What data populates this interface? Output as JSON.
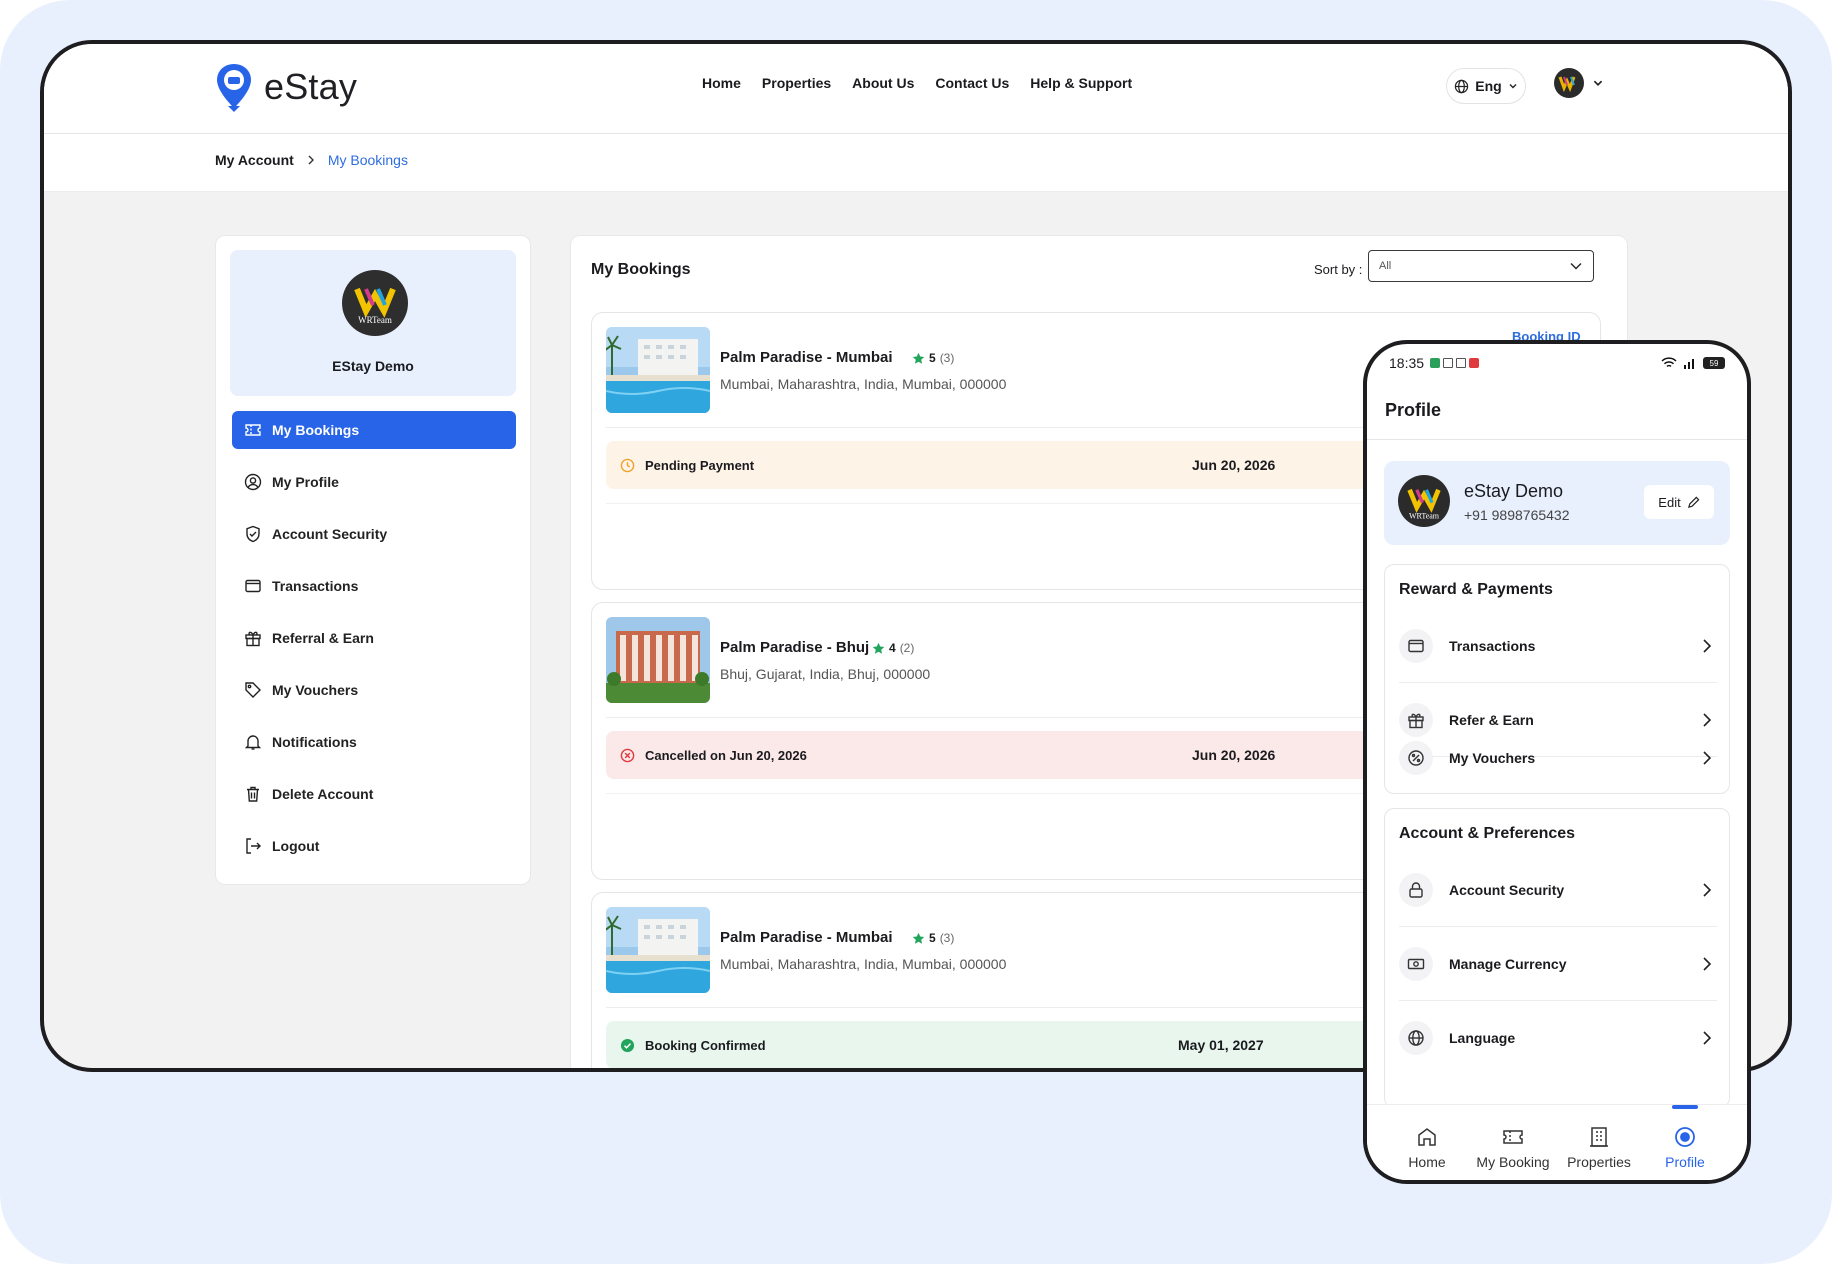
{
  "brand": {
    "name": "eStay"
  },
  "nav": [
    "Home",
    "Properties",
    "About Us",
    "Contact Us",
    "Help & Support"
  ],
  "language": "Eng",
  "breadcrumb": {
    "parent": "My Account",
    "current": "My Bookings"
  },
  "sidebar": {
    "user_name": "EStay Demo",
    "avatar_text": "WRTeam",
    "items": [
      {
        "label": "My Bookings",
        "icon": "ticket-icon"
      },
      {
        "label": "My Profile",
        "icon": "user-circle-icon"
      },
      {
        "label": "Account Security",
        "icon": "shield-icon"
      },
      {
        "label": "Transactions",
        "icon": "wallet-icon"
      },
      {
        "label": "Referral & Earn",
        "icon": "gift-icon"
      },
      {
        "label": "My Vouchers",
        "icon": "tag-icon"
      },
      {
        "label": "Notifications",
        "icon": "bell-icon"
      },
      {
        "label": "Delete Account",
        "icon": "trash-icon"
      },
      {
        "label": "Logout",
        "icon": "logout-icon"
      }
    ]
  },
  "bookings": {
    "title": "My Bookings",
    "sort_label": "Sort by :",
    "sort_value": "All",
    "booking_id_label": "Booking ID",
    "items": [
      {
        "name": "Palm Paradise - Mumbai",
        "rating": "5",
        "reviews": "(3)",
        "address": "Mumbai, Maharashtra, India, Mumbai, 000000",
        "status": "Pending Payment",
        "status_type": "pending",
        "date": "Jun 20, 2026"
      },
      {
        "name": "Palm Paradise - Bhuj",
        "rating": "4",
        "reviews": "(2)",
        "address": "Bhuj, Gujarat, India, Bhuj, 000000",
        "status": "Cancelled on Jun 20, 2026",
        "status_type": "cancelled",
        "date": "Jun 20, 2026"
      },
      {
        "name": "Palm Paradise - Mumbai",
        "rating": "5",
        "reviews": "(3)",
        "address": "Mumbai, Maharashtra, India, Mumbai, 000000",
        "status": "Booking Confirmed",
        "status_type": "confirmed",
        "date": "May 01, 2027"
      }
    ]
  },
  "colors": {
    "accent": "#2864e8",
    "pending_bg": "#fdf3e7",
    "cancelled_bg": "#fbe9e9",
    "confirmed_bg": "#e8f6ee",
    "star": "#22a45d"
  },
  "phone": {
    "time": "18:35",
    "battery": "59",
    "title": "Profile",
    "user_name": "eStay Demo",
    "user_phone": "+91 9898765432",
    "edit_label": "Edit",
    "sections": [
      {
        "title": "Reward & Payments",
        "items": [
          {
            "label": "Transactions",
            "icon": "wallet-icon"
          },
          {
            "label": "Refer & Earn",
            "icon": "gift-icon"
          },
          {
            "label": "My Vouchers",
            "icon": "voucher-icon"
          }
        ]
      },
      {
        "title": "Account & Preferences",
        "items": [
          {
            "label": "Account Security",
            "icon": "lock-icon"
          },
          {
            "label": "Manage Currency",
            "icon": "currency-icon"
          },
          {
            "label": "Language",
            "icon": "globe-icon"
          }
        ]
      }
    ],
    "tabs": [
      {
        "label": "Home",
        "icon": "home-icon"
      },
      {
        "label": "My Booking",
        "icon": "ticket-icon"
      },
      {
        "label": "Properties",
        "icon": "building-icon"
      },
      {
        "label": "Profile",
        "icon": "profile-icon"
      }
    ]
  }
}
